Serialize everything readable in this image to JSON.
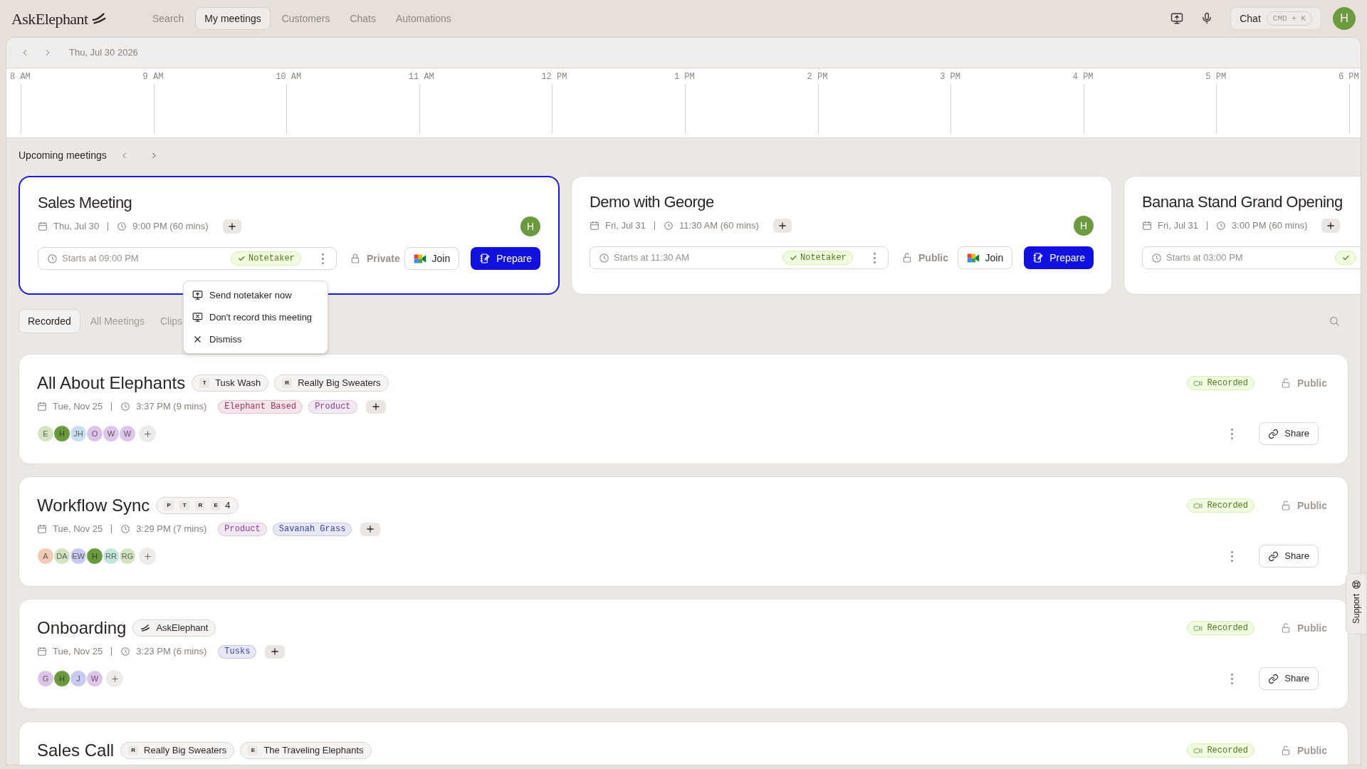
{
  "nav": {
    "logo": "AskElephant",
    "tabs": [
      {
        "label": "Search",
        "selected": false
      },
      {
        "label": "My meetings",
        "selected": true
      },
      {
        "label": "Customers",
        "selected": false
      },
      {
        "label": "Chats",
        "selected": false
      },
      {
        "label": "Automations",
        "selected": false
      }
    ],
    "chat": {
      "label": "Chat",
      "shortcut": "CMD + K"
    },
    "avatar": "H"
  },
  "date_bar": {
    "date": "Thu, Jul 30 2026"
  },
  "timeline": {
    "hours": [
      "8 AM",
      "9 AM",
      "10 AM",
      "11 AM",
      "12 PM",
      "1 PM",
      "2 PM",
      "3 PM",
      "4 PM",
      "5 PM",
      "6 PM"
    ]
  },
  "upcoming": {
    "title": "Upcoming meetings",
    "cards": [
      {
        "title": "Sales Meeting",
        "date": "Thu, Jul 30",
        "time": "9:00 PM (60 mins)",
        "avatar": "H",
        "starts": "Starts at 09:00 PM",
        "notetaker": "Notetaker",
        "privacy": {
          "label": "Private",
          "locked": true
        },
        "join": "Join",
        "prepare": "Prepare",
        "selected": true
      },
      {
        "title": "Demo with George",
        "date": "Fri, Jul 31",
        "time": "11:30 AM (60 mins)",
        "avatar": "H",
        "starts": "Starts at 11:30 AM",
        "notetaker": "Notetaker",
        "privacy": {
          "label": "Public",
          "locked": false
        },
        "join": "Join",
        "prepare": "Prepare",
        "selected": false
      },
      {
        "title": "Banana Stand Grand Opening",
        "date": "Fri, Jul 31",
        "time": "3:00 PM (60 mins)",
        "starts": "Starts at 03:00 PM",
        "selected": false
      }
    ]
  },
  "menu": {
    "items": [
      {
        "kind": "send",
        "label": "Send notetaker now"
      },
      {
        "kind": "no-record",
        "label": "Don't record this meeting"
      },
      {
        "kind": "dismiss",
        "label": "Dismiss"
      }
    ]
  },
  "filter_tabs": [
    {
      "label": "Recorded",
      "selected": true
    },
    {
      "label": "All Meetings",
      "selected": false
    },
    {
      "label": "Clips",
      "selected": false
    }
  ],
  "meetings": [
    {
      "title": "All About Elephants",
      "chips": [
        {
          "kind": "company",
          "initial": "T",
          "label": "Tusk Wash"
        },
        {
          "kind": "company",
          "initial": "R",
          "label": "Really Big Sweaters"
        }
      ],
      "date": "Tue, Nov 25",
      "time": "3:37 PM (9 mins)",
      "tags": [
        {
          "label": "Elephant Based",
          "color": "#a3325a"
        },
        {
          "label": "Product",
          "color": "#8a3f94"
        }
      ],
      "avatars": [
        {
          "initials": "E",
          "color": "#d4e3c2"
        },
        {
          "initials": "H",
          "color": "#6b9a3e"
        },
        {
          "initials": "JH",
          "color": "#c8dff0"
        },
        {
          "initials": "O",
          "color": "#dcc5e8"
        },
        {
          "initials": "W",
          "color": "#dcc5e8"
        },
        {
          "initials": "W",
          "color": "#dcc5e8"
        }
      ],
      "status": "Recorded",
      "privacy": {
        "label": "Public",
        "locked": false
      },
      "share": "Share"
    },
    {
      "title": "Workflow Sync",
      "chips": [
        {
          "kind": "group",
          "initials": [
            "P",
            "T",
            "R",
            "E"
          ],
          "count": "4"
        }
      ],
      "date": "Tue, Nov 25",
      "time": "3:29 PM (7 mins)",
      "tags": [
        {
          "label": "Product",
          "color": "#8a3f94"
        },
        {
          "label": "Savanah Grass",
          "color": "#3b45a8"
        }
      ],
      "avatars": [
        {
          "initials": "A",
          "color": "#f0cbb8"
        },
        {
          "initials": "DA",
          "color": "#d4e3c2"
        },
        {
          "initials": "EW",
          "color": "#c9caf0"
        },
        {
          "initials": "H",
          "color": "#6b9a3e"
        },
        {
          "initials": "RR",
          "color": "#c3e6e0"
        },
        {
          "initials": "RG",
          "color": "#d4e3c2"
        }
      ],
      "status": "Recorded",
      "privacy": {
        "label": "Public",
        "locked": false
      },
      "share": "Share"
    },
    {
      "title": "Onboarding",
      "chips": [
        {
          "kind": "logo",
          "label": "AskElephant"
        }
      ],
      "date": "Tue, Nov 25",
      "time": "3:23 PM (6 mins)",
      "tags": [
        {
          "label": "Tusks",
          "color": "#3b45a8"
        }
      ],
      "avatars": [
        {
          "initials": "G",
          "color": "#dcc5e8"
        },
        {
          "initials": "H",
          "color": "#6b9a3e"
        },
        {
          "initials": "J",
          "color": "#c9caf0"
        },
        {
          "initials": "W",
          "color": "#dcc5e8"
        }
      ],
      "status": "Recorded",
      "privacy": {
        "label": "Public",
        "locked": false
      },
      "share": "Share"
    },
    {
      "title": "Sales Call",
      "chips": [
        {
          "kind": "company",
          "initial": "R",
          "label": "Really Big Sweaters"
        },
        {
          "kind": "company",
          "initial": "E",
          "label": "The Traveling Elephants"
        }
      ],
      "status": "Recorded",
      "privacy": {
        "label": "Public",
        "locked": false
      }
    }
  ],
  "support": "Support"
}
